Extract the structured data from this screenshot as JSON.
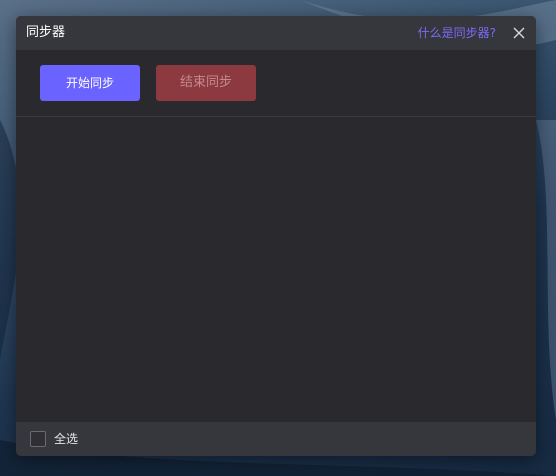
{
  "dialog": {
    "title": "同步器",
    "help_link": "什么是同步器?"
  },
  "toolbar": {
    "start_label": "开始同步",
    "stop_label": "结束同步"
  },
  "footer": {
    "select_all_label": "全选",
    "select_all_checked": false
  },
  "colors": {
    "primary": "#6a63ff",
    "danger": "#8c3a40",
    "link": "#7b6cf6",
    "panel": "#29292e",
    "header": "#36363d"
  },
  "icons": {
    "close": "close-icon"
  }
}
